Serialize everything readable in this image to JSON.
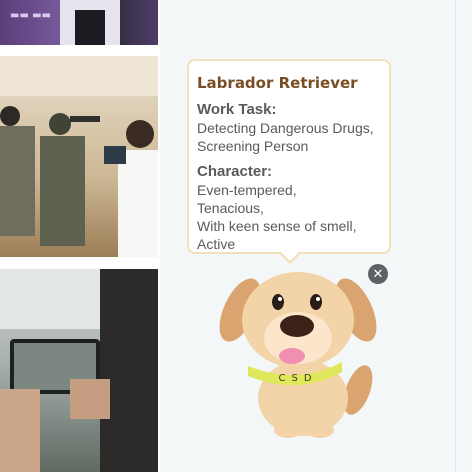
{
  "photos": [
    {
      "name": "event-photo-top"
    },
    {
      "name": "event-photo-display-board"
    },
    {
      "name": "event-photo-phone-shot"
    }
  ],
  "card": {
    "breed": "Labrador Retriever",
    "work_task_label": "Work Task:",
    "work_task_lines": [
      "Detecting Dangerous Drugs,",
      "Screening Person"
    ],
    "character_label": "Character:",
    "character_lines": [
      "Even-tempered,",
      "Tenacious,",
      "With keen sense of smell,",
      "Active"
    ]
  },
  "dog": {
    "collar_text": "CSD",
    "colors": {
      "fur": "#f3d3a8",
      "ears": "#d9a46f",
      "collar": "#dfe85a",
      "tongue": "#f08fb0"
    }
  },
  "icons": {
    "close": "close-icon"
  }
}
